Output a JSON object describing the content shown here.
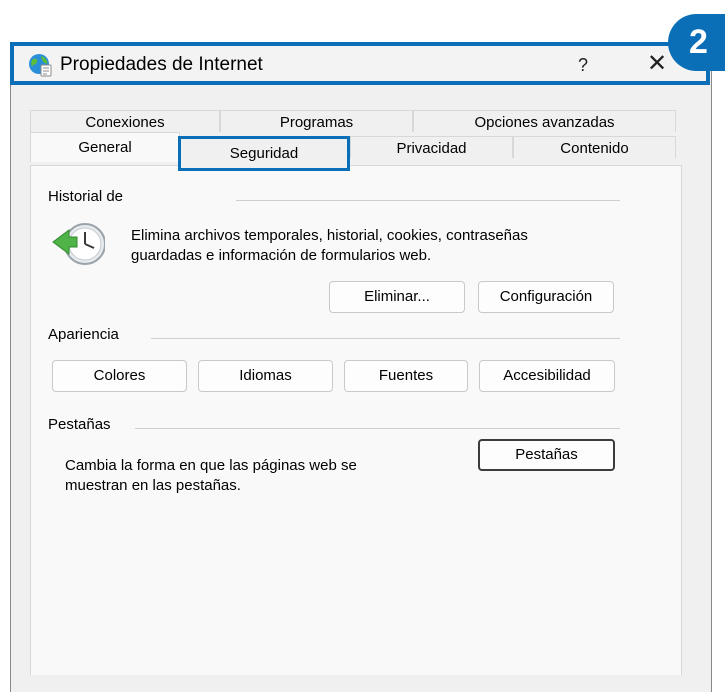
{
  "window": {
    "title": "Propiedades de Internet",
    "help_label": "?",
    "close_label": "✕",
    "badge": "2"
  },
  "tabs": {
    "row1": [
      {
        "label": "Conexiones"
      },
      {
        "label": "Programas"
      },
      {
        "label": "Opciones avanzadas"
      }
    ],
    "row2": [
      {
        "label": "General"
      },
      {
        "label": "Seguridad"
      },
      {
        "label": "Privacidad"
      },
      {
        "label": "Contenido"
      }
    ]
  },
  "history": {
    "label": "Historial de",
    "description_line1": "Elimina archivos temporales, historial, cookies, contraseñas",
    "description_line2": "guardadas e información de formularios web.",
    "delete_button": "Eliminar...",
    "settings_button": "Configuración"
  },
  "appearance": {
    "label": "Apariencia",
    "colors_button": "Colores",
    "languages_button": "Idiomas",
    "fonts_button": "Fuentes",
    "accessibility_button": "Accesibilidad"
  },
  "tabs_section": {
    "label": "Pestañas",
    "description_line1": "Cambia la forma en que las páginas web se",
    "description_line2": "muestran en las pestañas.",
    "tabs_button": "Pestañas"
  },
  "colors": {
    "highlight": "#0b6fb8",
    "window_bg": "#f0f0f0",
    "panel_bg": "#f9f9f9"
  }
}
